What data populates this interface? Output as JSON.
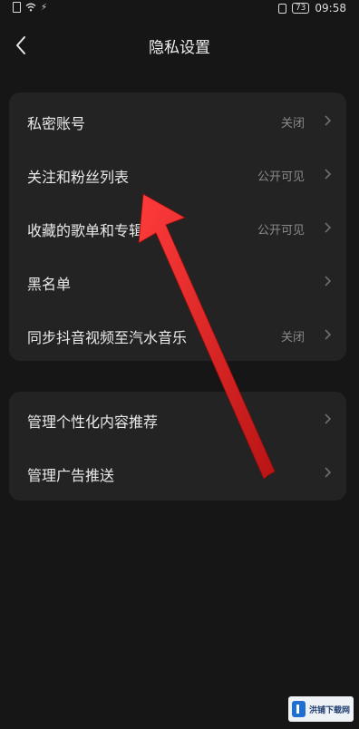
{
  "status_bar": {
    "time": "09:58",
    "battery": "73",
    "icons": [
      "sim-icon",
      "wifi-icon",
      "data-icon",
      "vibrate-icon",
      "battery-icon"
    ]
  },
  "header": {
    "title": "隐私设置",
    "back_icon": "chevron-left-icon"
  },
  "group1": {
    "items": [
      {
        "label": "私密账号",
        "value": "关闭"
      },
      {
        "label": "关注和粉丝列表",
        "value": "公开可见"
      },
      {
        "label": "收藏的歌单和专辑",
        "value": "公开可见"
      },
      {
        "label": "黑名单",
        "value": ""
      },
      {
        "label": "同步抖音视频至汽水音乐",
        "value": "关闭"
      }
    ]
  },
  "group2": {
    "items": [
      {
        "label": "管理个性化内容推荐",
        "value": ""
      },
      {
        "label": "管理广告推送",
        "value": ""
      }
    ]
  },
  "watermark": {
    "text": "洪铺下载网"
  },
  "colors": {
    "background": "#161616",
    "card": "#232323",
    "arrow": "#d41f1f",
    "value_text": "#8a8a8a"
  }
}
